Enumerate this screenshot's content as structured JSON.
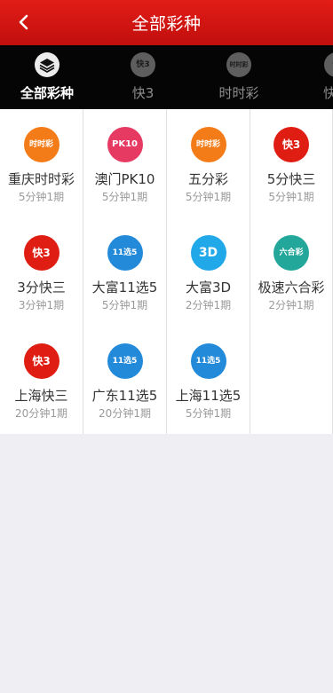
{
  "header": {
    "title": "全部彩种",
    "back_icon": "chevron-left-icon"
  },
  "tabs": [
    {
      "label": "全部彩种",
      "icon": "layers-icon",
      "active": true
    },
    {
      "label": "快3",
      "icon": "k3-badge-icon",
      "active": false
    },
    {
      "label": "时时彩",
      "icon": "ssc-badge-icon",
      "active": false
    },
    {
      "label": "快乐",
      "icon": "kl-badge-icon",
      "active": false
    }
  ],
  "games": [
    {
      "name": "重庆时时彩",
      "period": "5分钟1期",
      "logo": "ssc",
      "logo_text": "时时彩"
    },
    {
      "name": "澳门PK10",
      "period": "5分钟1期",
      "logo": "pk10",
      "logo_text": "PK10"
    },
    {
      "name": "五分彩",
      "period": "5分钟1期",
      "logo": "ssc",
      "logo_text": "时时彩"
    },
    {
      "name": "5分快三",
      "period": "5分钟1期",
      "logo": "k3",
      "logo_text": "快3"
    },
    {
      "name": "3分快三",
      "period": "3分钟1期",
      "logo": "k3",
      "logo_text": "快3"
    },
    {
      "name": "大富11选5",
      "period": "5分钟1期",
      "logo": "x5",
      "logo_text": "11选5"
    },
    {
      "name": "大富3D",
      "period": "2分钟1期",
      "logo": "d3",
      "logo_text": "3D"
    },
    {
      "name": "极速六合彩",
      "period": "2分钟1期",
      "logo": "lhc",
      "logo_text": "六合彩"
    },
    {
      "name": "上海快三",
      "period": "20分钟1期",
      "logo": "k3",
      "logo_text": "快3"
    },
    {
      "name": "广东11选5",
      "period": "20分钟1期",
      "logo": "x5",
      "logo_text": "11选5"
    },
    {
      "name": "上海11选5",
      "period": "5分钟1期",
      "logo": "x5",
      "logo_text": "11选5"
    }
  ],
  "colors": {
    "header": "#d5150f",
    "tabs_bg": "#050505",
    "ssc": "#f47c18",
    "pk10": "#e63a63",
    "k3": "#df1d13",
    "x5": "#2389d9",
    "d3": "#21a8e8",
    "lhc": "#22a79a"
  }
}
